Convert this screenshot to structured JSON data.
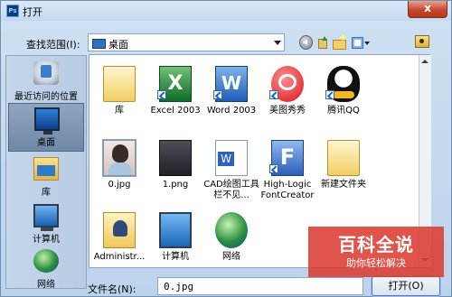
{
  "window": {
    "title": "打开",
    "close_glyph": "x"
  },
  "toolbar": {
    "look_in_label": "查找范围(I):",
    "look_in_value": "桌面"
  },
  "places": [
    {
      "label": "最近访问的位置",
      "icon": "recent-places-icon"
    },
    {
      "label": "桌面",
      "icon": "desktop-icon",
      "selected": true
    },
    {
      "label": "库",
      "icon": "library-icon"
    },
    {
      "label": "计算机",
      "icon": "computer-icon"
    },
    {
      "label": "网络",
      "icon": "network-icon"
    }
  ],
  "files": [
    {
      "name": "库",
      "icon": "library-folder-icon",
      "shortcut": false
    },
    {
      "name": "Excel 2003",
      "icon": "excel-icon",
      "shortcut": true
    },
    {
      "name": "Word 2003",
      "icon": "word-icon",
      "shortcut": true
    },
    {
      "name": "美图秀秀",
      "icon": "meitu-icon",
      "shortcut": true
    },
    {
      "name": "腾讯QQ",
      "icon": "qq-icon",
      "shortcut": true
    },
    {
      "name": "0.jpg",
      "icon": "photo-thumbnail-icon",
      "shortcut": false,
      "selected": true
    },
    {
      "name": "1.png",
      "icon": "image-thumbnail-icon",
      "shortcut": false
    },
    {
      "name": "CAD绘图工具栏不见...",
      "icon": "word-document-icon",
      "shortcut": false
    },
    {
      "name": "High-Logic FontCreator",
      "icon": "fontcreator-icon",
      "shortcut": true
    },
    {
      "name": "新建文件夹",
      "icon": "folder-icon",
      "shortcut": false
    },
    {
      "name": "Administr...",
      "icon": "user-folder-icon",
      "shortcut": false
    },
    {
      "name": "计算机",
      "icon": "computer-icon",
      "shortcut": false
    },
    {
      "name": "网络",
      "icon": "network-icon",
      "shortcut": false
    }
  ],
  "footer": {
    "filename_label": "文件名(N):",
    "filename_value": "0.jpg",
    "open_label": "打开(O)"
  },
  "watermark": {
    "main": "百科全说",
    "sub": "助你轻松解决"
  }
}
